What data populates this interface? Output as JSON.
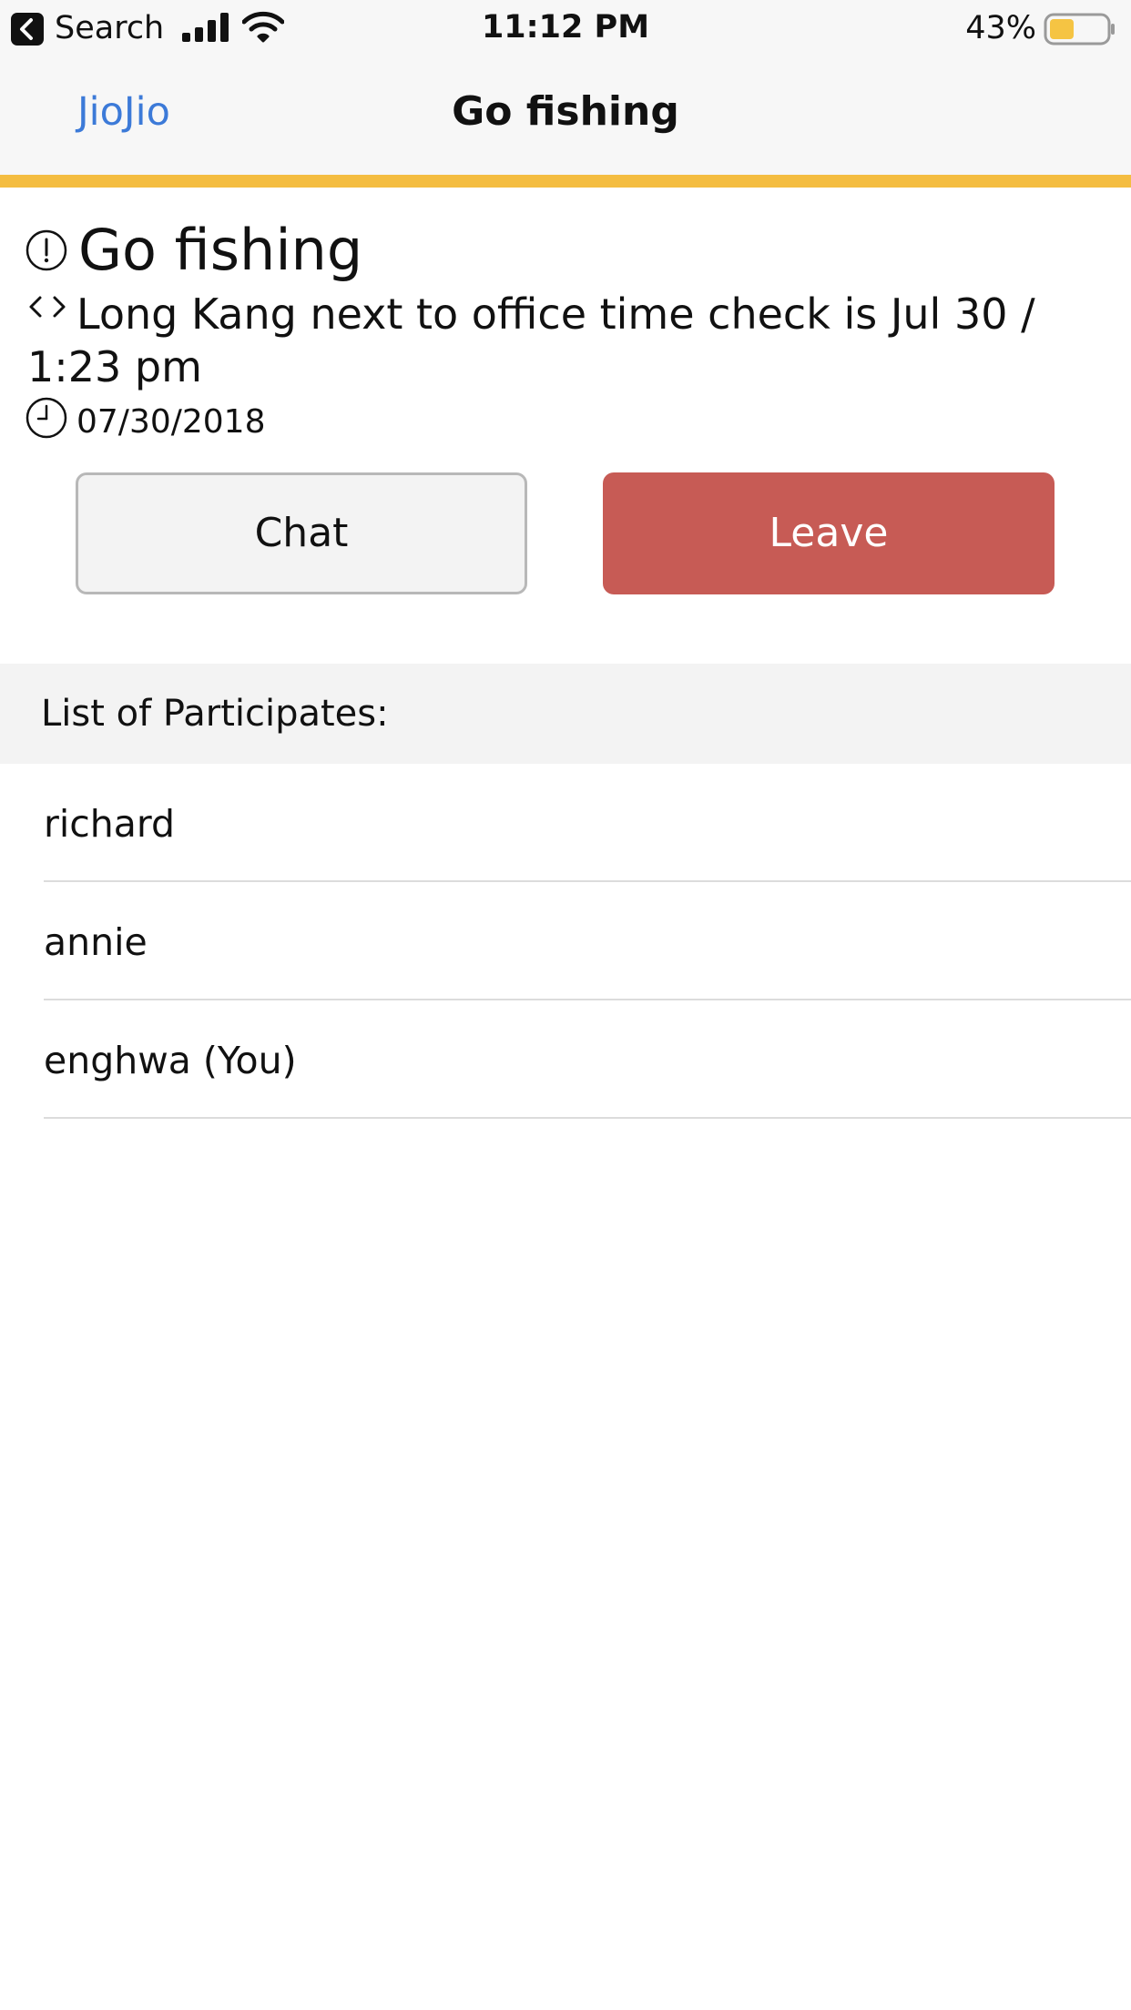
{
  "status_bar": {
    "back_label": "Search",
    "time": "11:12 PM",
    "battery_percent": "43%",
    "battery_level": 0.43,
    "battery_color": "#f5c443",
    "signal_bars": 4,
    "icons": [
      "back-arrow-icon",
      "cellular-signal-icon",
      "wifi-icon",
      "battery-icon"
    ]
  },
  "navbar": {
    "back_label": "JioJio",
    "title": "Go fishing",
    "link_color": "#3c7ad8"
  },
  "accent_color": "#f4bd41",
  "event": {
    "title": "Go fishing",
    "title_icon": "alert-circle-icon",
    "location": "Long Kang next to office time check is Jul 30 / 1:23 pm",
    "location_icon": "code-icon",
    "date": "07/30/2018",
    "date_icon": "clock-icon"
  },
  "actions": {
    "chat_label": "Chat",
    "leave_label": "Leave",
    "leave_color": "#c75b55"
  },
  "participants_section": {
    "header": "List of Participates:",
    "items": [
      {
        "name": "richard"
      },
      {
        "name": "annie"
      },
      {
        "name": "enghwa (You)"
      }
    ]
  }
}
